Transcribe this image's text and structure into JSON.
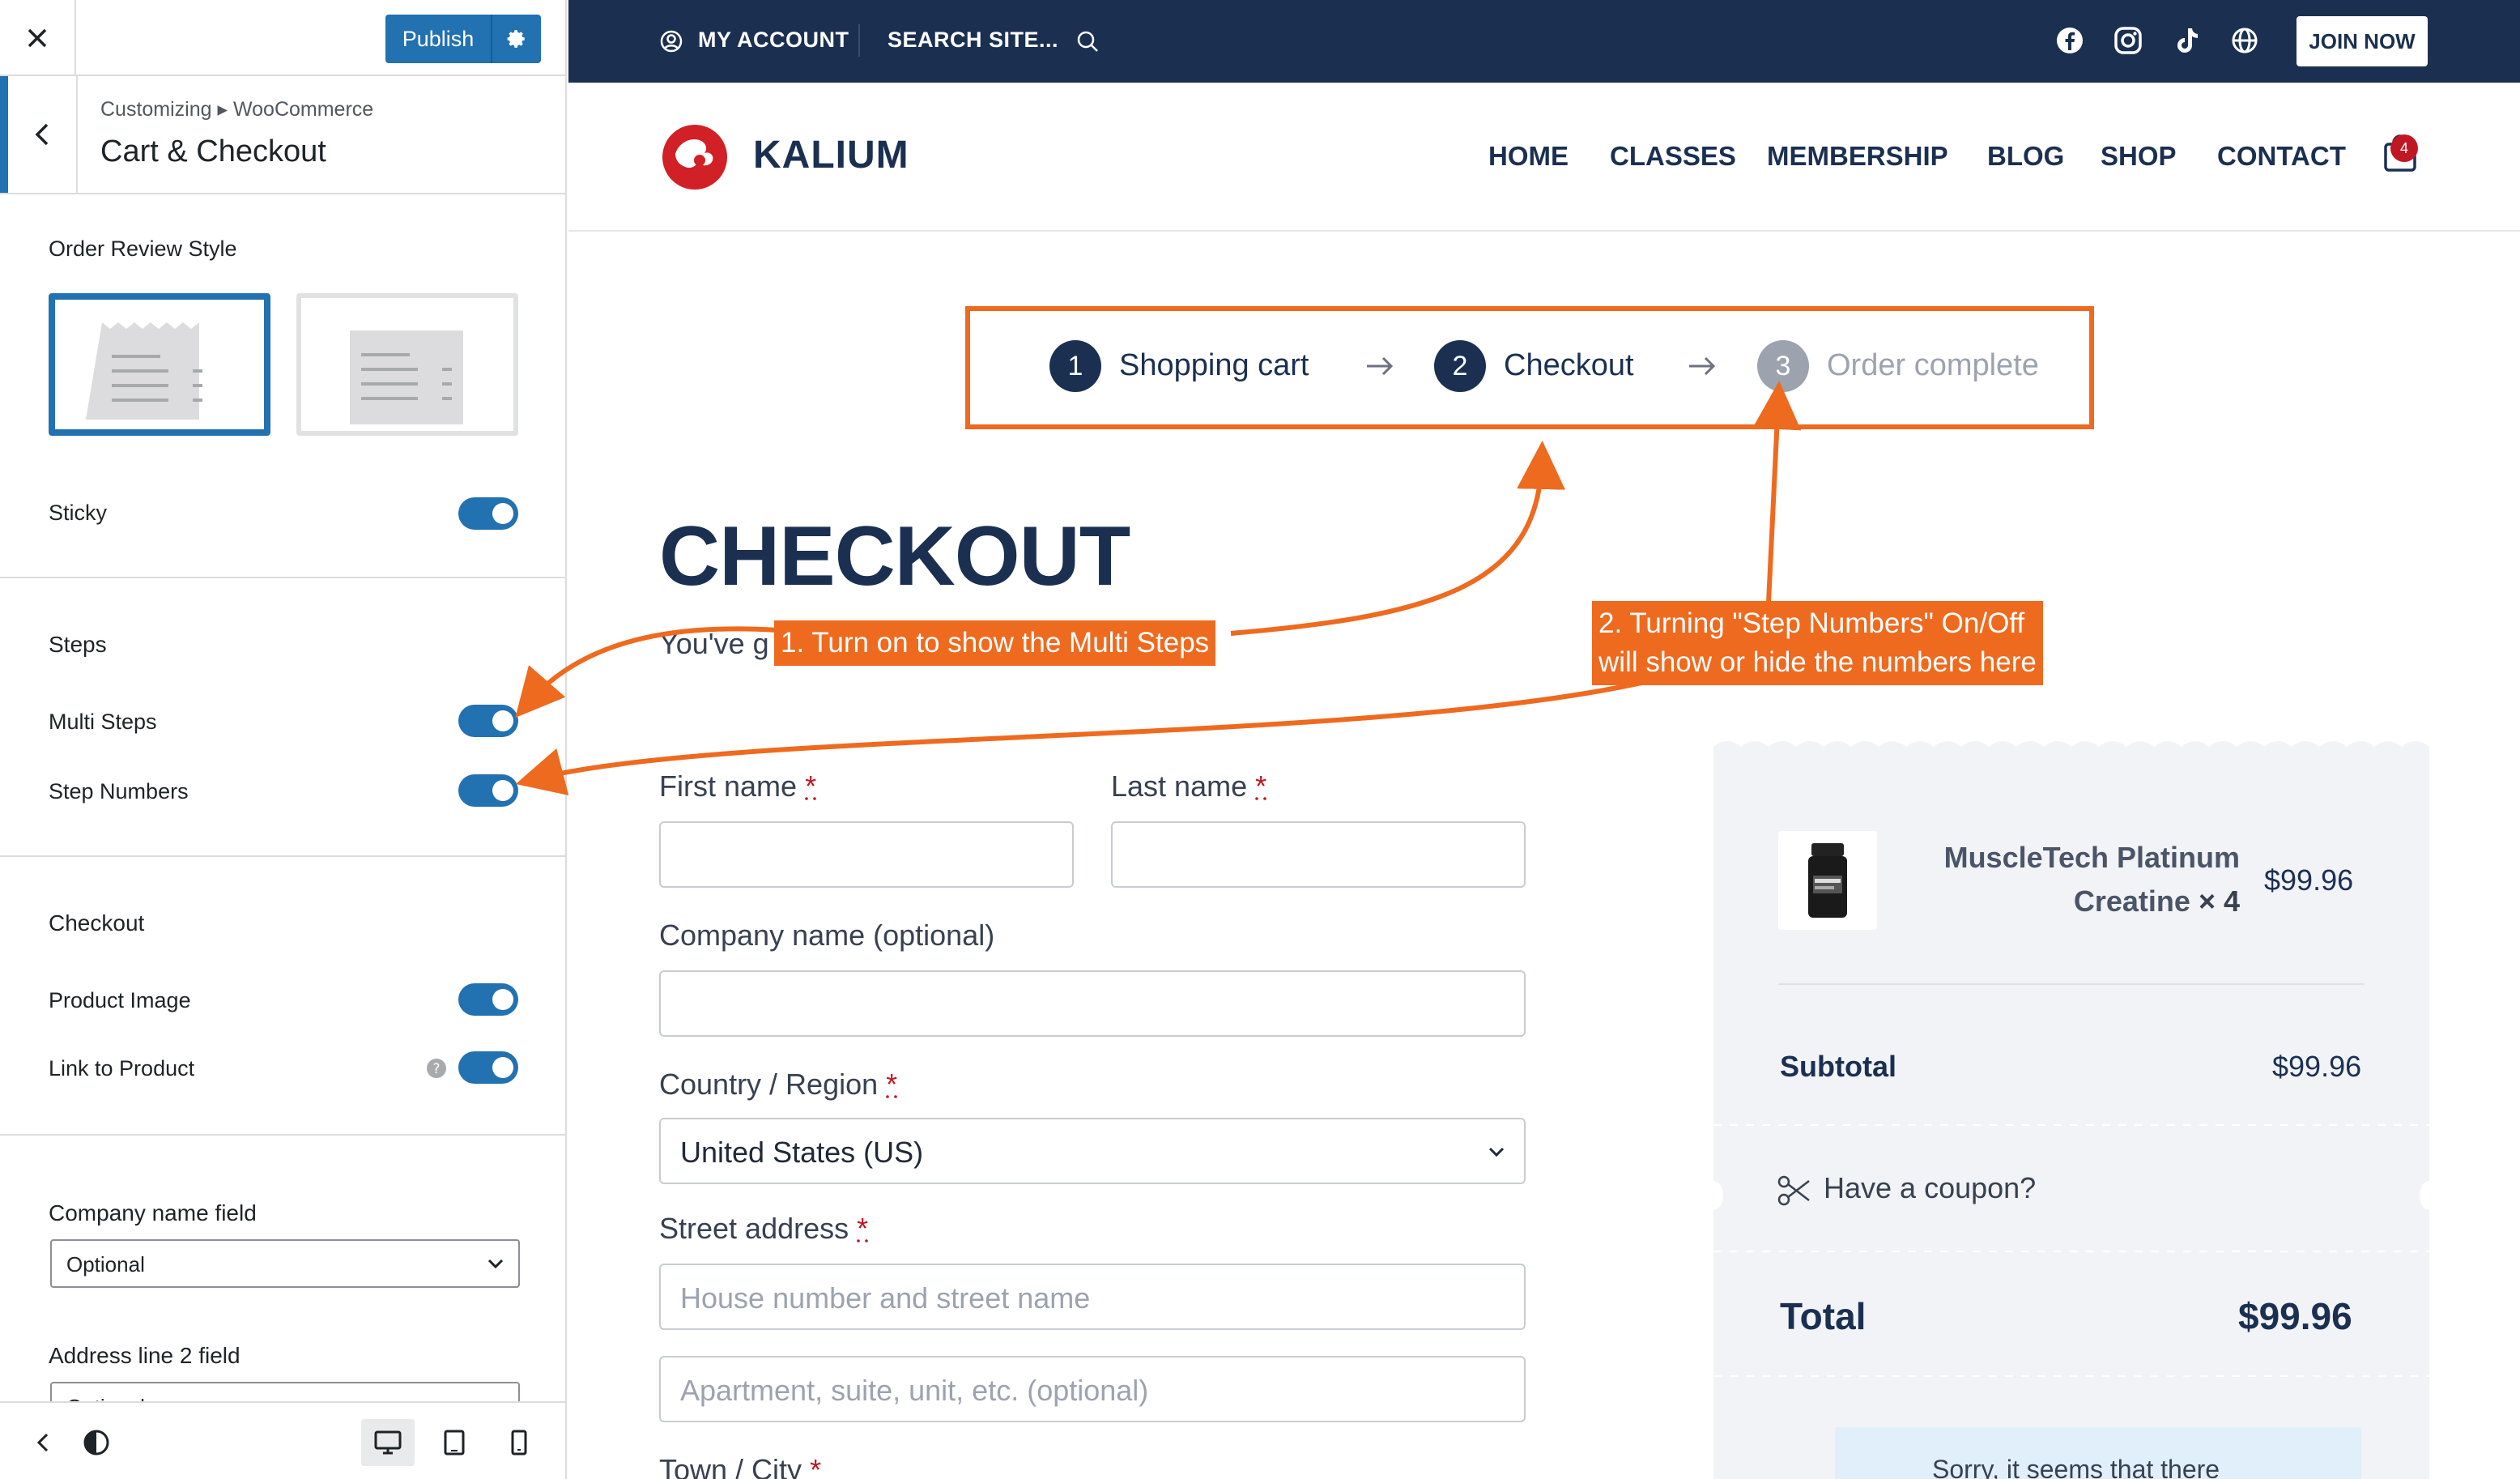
{
  "customizer": {
    "close_icon": "close-icon",
    "publish_label": "Publish",
    "breadcrumb": "Customizing ▸ WooCommerce",
    "section_title": "Cart & Checkout",
    "order_review_style_label": "Order Review Style",
    "selected_style": 1,
    "sticky_label": "Sticky",
    "steps_heading": "Steps",
    "multi_steps_label": "Multi Steps",
    "step_numbers_label": "Step Numbers",
    "checkout_heading": "Checkout",
    "product_image_label": "Product Image",
    "link_to_product_label": "Link to Product",
    "company_field_label": "Company name field",
    "company_field_value": "Optional",
    "address2_field_label": "Address line 2 field",
    "address2_field_value": "Optional",
    "toggles": {
      "sticky": true,
      "multi_steps": true,
      "step_numbers": true,
      "product_image": true,
      "link_to_product": true
    },
    "accent_color": "#2271b1"
  },
  "site": {
    "topbar": {
      "account": "MY ACCOUNT",
      "search": "SEARCH SITE...",
      "join": "JOIN NOW",
      "social_icons": [
        "facebook-icon",
        "instagram-icon",
        "tiktok-icon",
        "globe-icon"
      ]
    },
    "logo": "KALIUM",
    "nav": [
      "HOME",
      "CLASSES",
      "MEMBERSHIP",
      "BLOG",
      "SHOP",
      "CONTACT"
    ],
    "cart_count": "4",
    "steps": [
      {
        "number": "1",
        "label": "Shopping cart"
      },
      {
        "number": "2",
        "label": "Checkout"
      },
      {
        "number": "3",
        "label": "Order complete"
      }
    ],
    "title": "CHECKOUT",
    "intro_visible": "You've g",
    "fields": {
      "first_name": "First name",
      "last_name": "Last name",
      "company": "Company name (optional)",
      "country": "Country / Region",
      "country_value": "United States (US)",
      "street": "Street address",
      "street_placeholder": "House number and street name",
      "street2_placeholder": "Apartment, suite, unit, etc. (optional)",
      "town": "Town / City",
      "required_mark": "*"
    },
    "summary": {
      "product_name": "MuscleTech Platinum Creatine",
      "quantity": "× 4",
      "product_price": "$99.96",
      "subtotal_label": "Subtotal",
      "subtotal_value": "$99.96",
      "coupon_label": "Have a coupon?",
      "total_label": "Total",
      "total_value": "$99.96",
      "notice_text": "Sorry, it seems that there"
    },
    "brand_color": "#1b3051"
  },
  "annotations": {
    "callout_1": "1. Turn on to show the Multi Steps",
    "callout_2_line1": "2. Turning \"Step Numbers\" On/Off",
    "callout_2_line2": "will show or hide the numbers here",
    "color": "#ee6a1f"
  }
}
